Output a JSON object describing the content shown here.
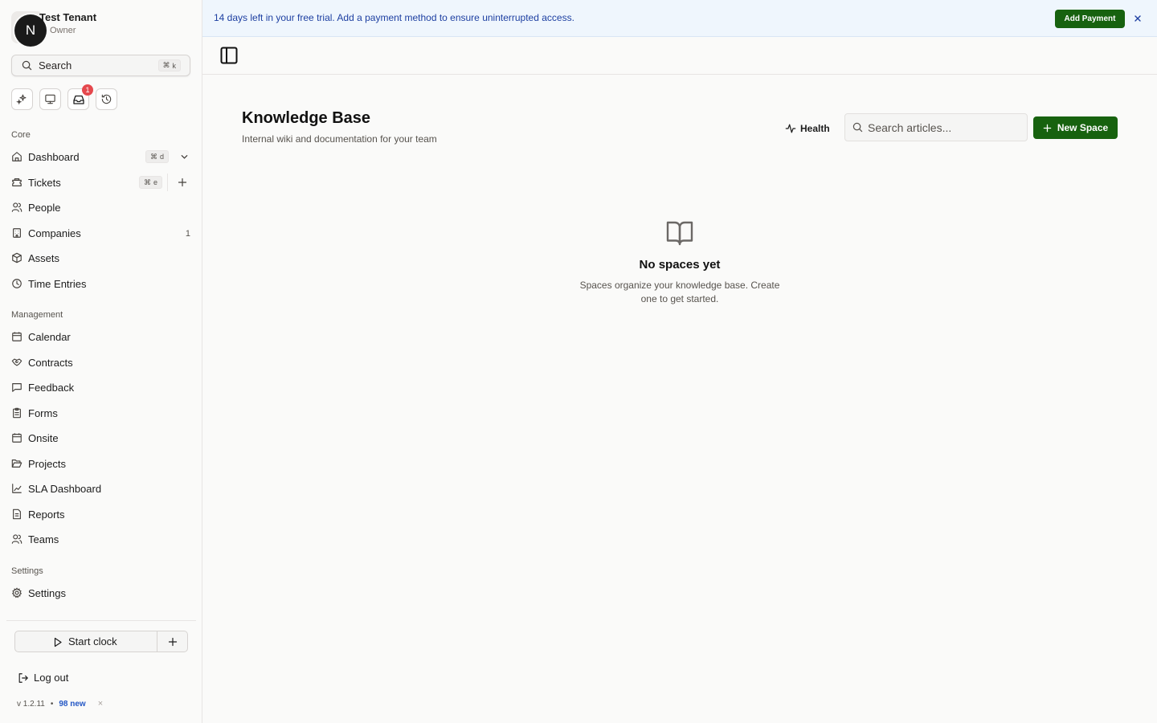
{
  "tenant": {
    "avatar_letter": "N",
    "name": "Test Tenant",
    "role": "Owner"
  },
  "search": {
    "label": "Search",
    "kbd_symbol": "⌘",
    "kbd_key": "k"
  },
  "quick_actions": [
    {
      "icon": "sparkles-icon"
    },
    {
      "icon": "monitor-icon"
    },
    {
      "icon": "inbox-icon",
      "badge": "1"
    },
    {
      "icon": "history-icon"
    }
  ],
  "sections": {
    "core": "Core",
    "management": "Management",
    "settings": "Settings"
  },
  "nav": {
    "dashboard": {
      "label": "Dashboard",
      "kbd": "d"
    },
    "tickets": {
      "label": "Tickets",
      "kbd": "e"
    },
    "people": {
      "label": "People"
    },
    "companies": {
      "label": "Companies",
      "count": "1"
    },
    "assets": {
      "label": "Assets"
    },
    "time_entries": {
      "label": "Time Entries"
    },
    "calendar": {
      "label": "Calendar"
    },
    "contracts": {
      "label": "Contracts"
    },
    "feedback": {
      "label": "Feedback"
    },
    "forms": {
      "label": "Forms"
    },
    "onsite": {
      "label": "Onsite"
    },
    "projects": {
      "label": "Projects"
    },
    "sla_dashboard": {
      "label": "SLA Dashboard"
    },
    "reports": {
      "label": "Reports"
    },
    "teams": {
      "label": "Teams"
    },
    "settings": {
      "label": "Settings"
    }
  },
  "kbd_symbol": "⌘",
  "footer": {
    "start_clock": "Start clock",
    "logout": "Log out",
    "version": "v 1.2.11",
    "dot": "•",
    "new_count": "98 new",
    "dismiss": "×"
  },
  "banner": {
    "message": "14 days left in your free trial. Add a payment method to ensure uninterrupted access.",
    "button": "Add Payment",
    "close": "×"
  },
  "page": {
    "title": "Knowledge Base",
    "subtitle": "Internal wiki and documentation for your team",
    "health_label": "Health",
    "search_placeholder": "Search articles...",
    "new_space_label": "New Space",
    "empty_title": "No spaces yet",
    "empty_desc": "Spaces organize your knowledge base. Create one to get started."
  },
  "colors": {
    "primary_green": "#17620f",
    "banner_bg": "#eff6fd",
    "banner_text": "#1d3fa1",
    "badge_red": "#e5484d",
    "link_blue": "#2457c5"
  }
}
